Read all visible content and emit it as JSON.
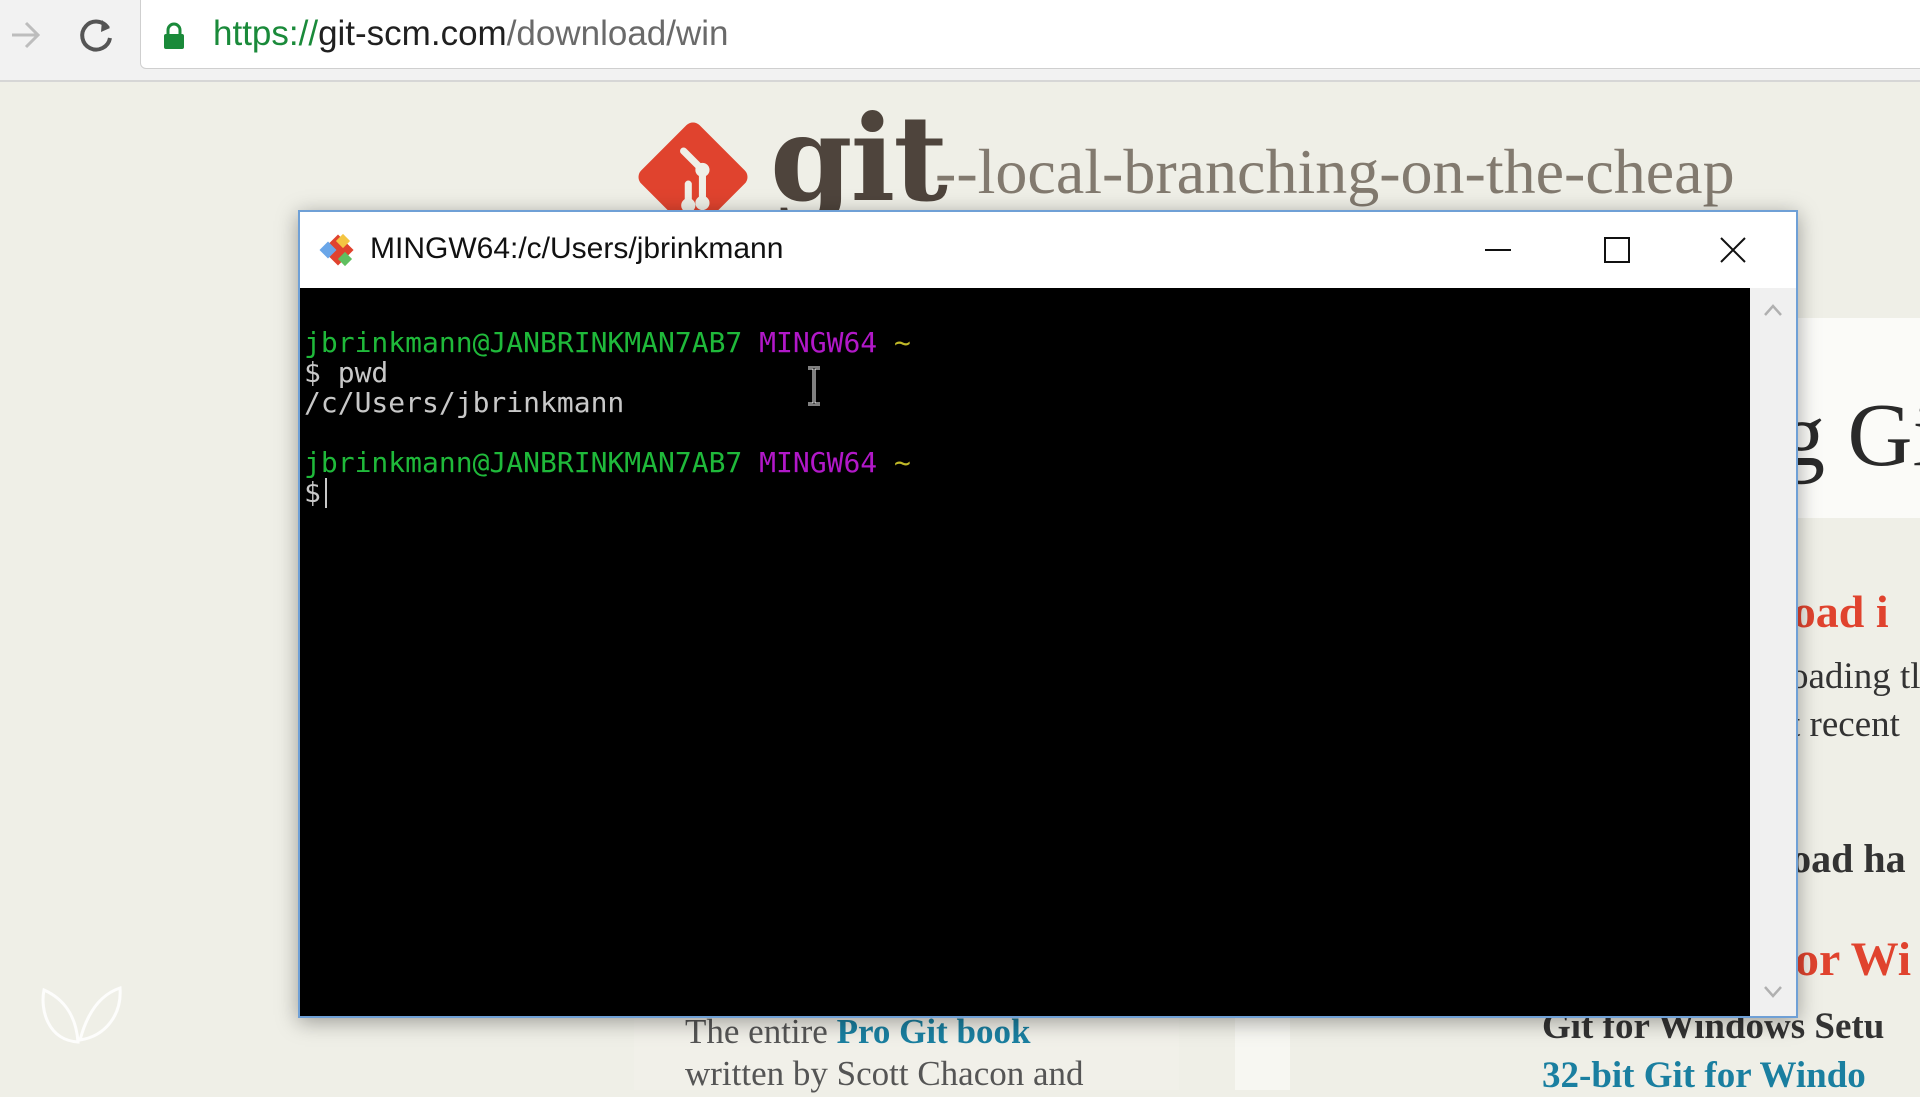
{
  "browser": {
    "url_protocol": "https://",
    "url_domain": "git-scm.com",
    "url_path": "/download/win",
    "icons": [
      "forward-arrow-icon",
      "reload-icon",
      "lock-icon"
    ]
  },
  "web_page": {
    "logo_wordmark": "git",
    "tagline": "--local-branching-on-the-cheap",
    "heading_fragment": "g Gi",
    "download_heading_fragment": "load i",
    "downloading_text_fragment": "oading tl",
    "recent_text_fragment": "t recent",
    "download_hash_fragment": "load ha",
    "for_windows_fragment": "or Wi",
    "git_setup_fragment": "Git for Windows Setu",
    "bit_link_fragment": "32-bit Git for Windo",
    "book_line1_prefix": "The entire ",
    "book_link": "Pro Git book",
    "book_line2": "written by Scott Chacon and",
    "colors": {
      "accent": "#e0432e",
      "link": "#1a7fa0",
      "wordmark": "#4e443c"
    }
  },
  "terminal": {
    "title": "MINGW64:/c/Users/jbrinkmann",
    "prompt_user": "jbrinkmann@JANBRINKMAN7AB7",
    "prompt_env": "MINGW64",
    "prompt_dir": "~",
    "prompt_symbol": "$",
    "command": "pwd",
    "output": "/c/Users/jbrinkmann",
    "colors": {
      "user": "#1fb93a",
      "env": "#b118c8",
      "dir": "#c0b928",
      "text": "#c8c8c8"
    },
    "window_buttons": [
      "minimize-icon",
      "maximize-icon",
      "close-icon"
    ]
  }
}
